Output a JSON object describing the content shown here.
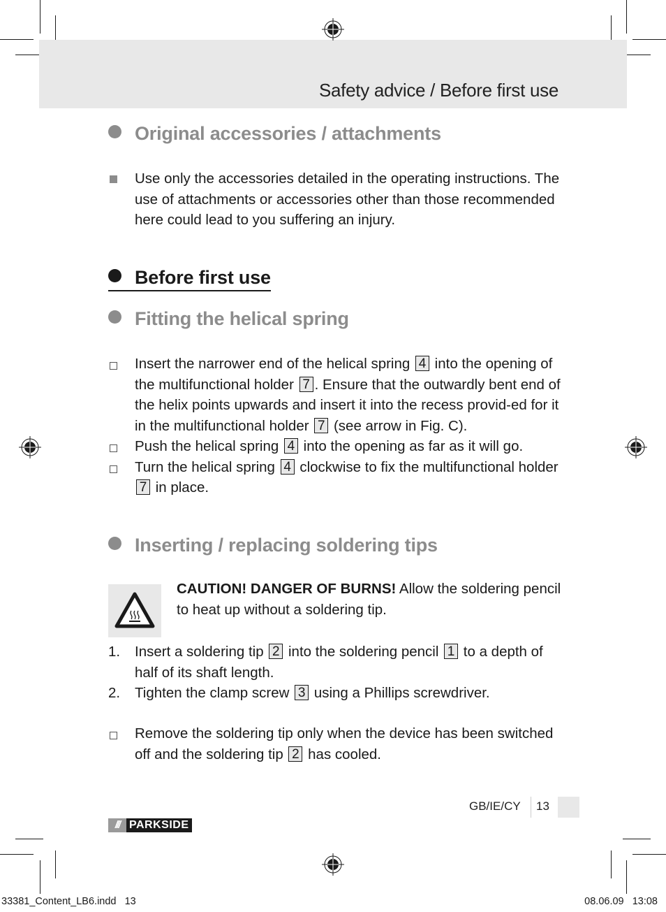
{
  "header": {
    "title": "Safety advice / Before first use"
  },
  "sections": {
    "accessories": {
      "heading": "Original accessories / attachments",
      "text": "Use only the accessories detailed in the operating instructions. The use of attachments or accessories other than those recommended here could lead to you suffering an injury."
    },
    "before_first_use": {
      "heading": "Before first use"
    },
    "helical_spring": {
      "heading": "Fitting the helical spring",
      "items": [
        {
          "parts": [
            "Insert the narrower end of the helical spring ",
            "4",
            " into the opening of the multifunctional holder ",
            "7",
            ". Ensure that the outwardly bent end of the helix points upwards and insert it into the recess provid-ed for it in the multifunctional holder ",
            "7",
            " (see arrow in Fig. C)."
          ]
        },
        {
          "parts": [
            "Push the helical spring ",
            "4",
            " into the opening as far as it will go."
          ]
        },
        {
          "parts": [
            "Turn the helical spring ",
            "4",
            " clockwise to fix the multifunctional holder ",
            "7",
            " in place."
          ]
        }
      ]
    },
    "soldering_tips": {
      "heading": "Inserting / replacing soldering tips",
      "warning": {
        "icon": "hot-surface-warning-icon",
        "bold": "CAUTION! DANGER OF BURNS!",
        "text": " Allow the soldering pencil to heat up without a soldering tip."
      },
      "steps": [
        {
          "number": "1.",
          "parts": [
            "Insert a soldering tip ",
            "2",
            " into the soldering pencil ",
            "1",
            " to a depth of half of its shaft length."
          ]
        },
        {
          "number": "2.",
          "parts": [
            "Tighten the clamp screw ",
            "3",
            " using a Phillips screwdriver."
          ]
        }
      ],
      "note": {
        "parts": [
          "Remove the soldering tip only when the device has been switched off and the soldering tip ",
          "2",
          " has cooled."
        ]
      }
    }
  },
  "footer": {
    "region": "GB/IE/CY",
    "page": "13",
    "logo_slash": "///",
    "logo_name": "PARKSIDE"
  },
  "print_slug": {
    "file": "33381_Content_LB6.indd   13",
    "date": "08.06.09   13:08"
  },
  "colors": {
    "heading_grey": "#8c8c8c",
    "band_grey": "#e8e8e8",
    "text": "#1a1a1a"
  }
}
